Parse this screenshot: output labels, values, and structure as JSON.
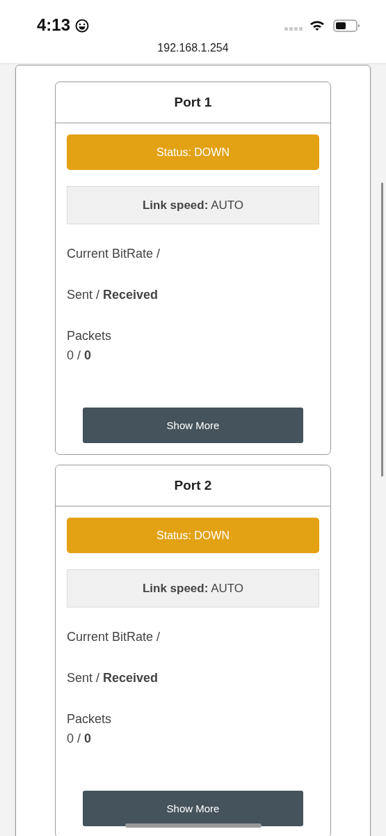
{
  "status_bar": {
    "time": "4:13"
  },
  "address_bar": {
    "url": "192.168.1.254"
  },
  "ports": [
    {
      "title": "Port 1",
      "status": "Status: DOWN",
      "link_speed": "**Link speed:** AUTO",
      "bitrate_label": "Current BitRate /",
      "sent_received": "Sent / **Received**",
      "packets_label": "Packets",
      "packets_value": "0 / **0**",
      "button": "Show More"
    },
    {
      "title": "Port 2",
      "status": "Status: DOWN",
      "link_speed": "**Link speed:** AUTO",
      "bitrate_label": "Current BitRate /",
      "sent_received": "Sent / **Received**",
      "packets_label": "Packets",
      "packets_value": "0 / **0**",
      "button": "Show More"
    }
  ]
}
